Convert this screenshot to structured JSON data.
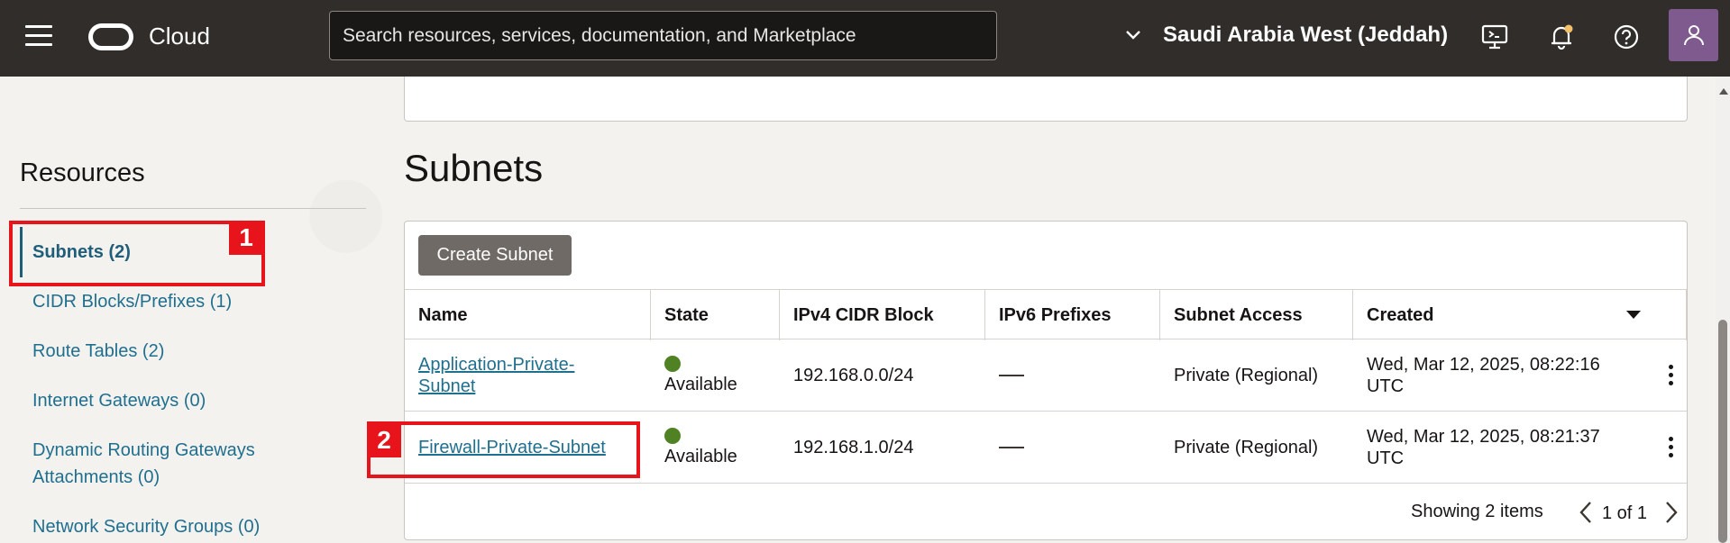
{
  "header": {
    "brand": "Cloud",
    "search_placeholder": "Search resources, services, documentation, and Marketplace",
    "region": "Saudi Arabia West (Jeddah)"
  },
  "sidebar": {
    "title": "Resources",
    "items": [
      {
        "label": "Subnets (2)",
        "active": true
      },
      {
        "label": "CIDR Blocks/Prefixes (1)"
      },
      {
        "label": "Route Tables (2)"
      },
      {
        "label": "Internet Gateways (0)"
      },
      {
        "label": "Dynamic Routing Gateways"
      },
      {
        "label": "Attachments (0)"
      },
      {
        "label": "Network Security Groups (0)"
      }
    ]
  },
  "main": {
    "title": "Subnets",
    "create_button": "Create Subnet",
    "columns": [
      "Name",
      "State",
      "IPv4 CIDR Block",
      "IPv6 Prefixes",
      "Subnet Access",
      "Created"
    ],
    "rows": [
      {
        "name_line1": "Application-Private-",
        "name_line2": "Subnet",
        "state": "Available",
        "ipv4": "192.168.0.0/24",
        "ipv6": "",
        "access": "Private (Regional)",
        "created_line1": "Wed, Mar 12, 2025, 08:22:16",
        "created_line2": "UTC"
      },
      {
        "name_line1": "Firewall-Private-Subnet",
        "state": "Available",
        "ipv4": "192.168.1.0/24",
        "ipv6": "",
        "access": "Private (Regional)",
        "created_line1": "Wed, Mar 12, 2025, 08:21:37",
        "created_line2": "UTC"
      }
    ],
    "showing": "Showing 2 items",
    "page": "1 of 1"
  },
  "annotations": {
    "one": "1",
    "two": "2",
    "color": "#e8141b"
  },
  "colors": {
    "header_bg": "#312d2a",
    "link": "#1f6f8f",
    "available_dot": "#508223"
  }
}
